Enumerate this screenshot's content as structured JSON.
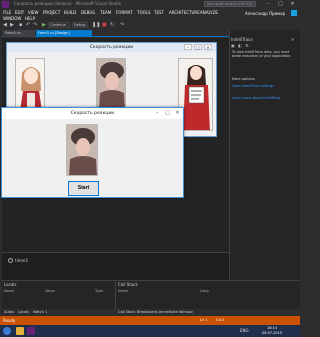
{
  "window": {
    "title": "Скорость реакции (Запуск) - Microsoft Visual Studio",
    "quick_launch_placeholder": "Быстрый запуск (Ctrl+Q)"
  },
  "menu": {
    "items": [
      "FILE",
      "EDIT",
      "VIEW",
      "PROJECT",
      "BUILD",
      "DEBUG",
      "TEAM",
      "FORMAT",
      "TOOLS",
      "TEST",
      "ARCHITECTURE",
      "ANALYZE",
      "WINDOW",
      "HELP"
    ],
    "account": "Александр Примар"
  },
  "toolbar": {
    "continue_label": "Continue",
    "config": "Debug"
  },
  "tabs": {
    "inactive": "Form1.cs",
    "active": "Form1.cs [Design]"
  },
  "designer": {
    "form_title": "Скорость реакции",
    "component_tray": "timer1"
  },
  "running_form": {
    "title": "Скорость реакции",
    "start_button": "Start"
  },
  "intellitrace": {
    "title": "IntelliTrace",
    "description": "To view IntelliTrace data, you must break execution of your application.",
    "more_options": "More options",
    "link1": "Open IntelliTrace settings",
    "link2": "Learn more about IntelliTrace"
  },
  "bottom": {
    "locals_title": "Locals",
    "callstack_title": "Call Stack",
    "locals_cols": [
      "Name",
      "Value",
      "Type"
    ],
    "callstack_cols": [
      "Name",
      "Lang"
    ],
    "tabs": [
      "Autos",
      "Locals",
      "Watch 1",
      "Call Stack",
      "Breakpoints",
      "Immediate Window"
    ]
  },
  "status": {
    "text": "Ready",
    "ln": "Ln 1",
    "col": "Col 1"
  },
  "taskbar": {
    "time": "16:14",
    "date": "06.07.2015",
    "lang": "ENG"
  },
  "colors": {
    "accent": "#007acc",
    "status_debug": "#ca5100",
    "vs_purple": "#68217a"
  }
}
